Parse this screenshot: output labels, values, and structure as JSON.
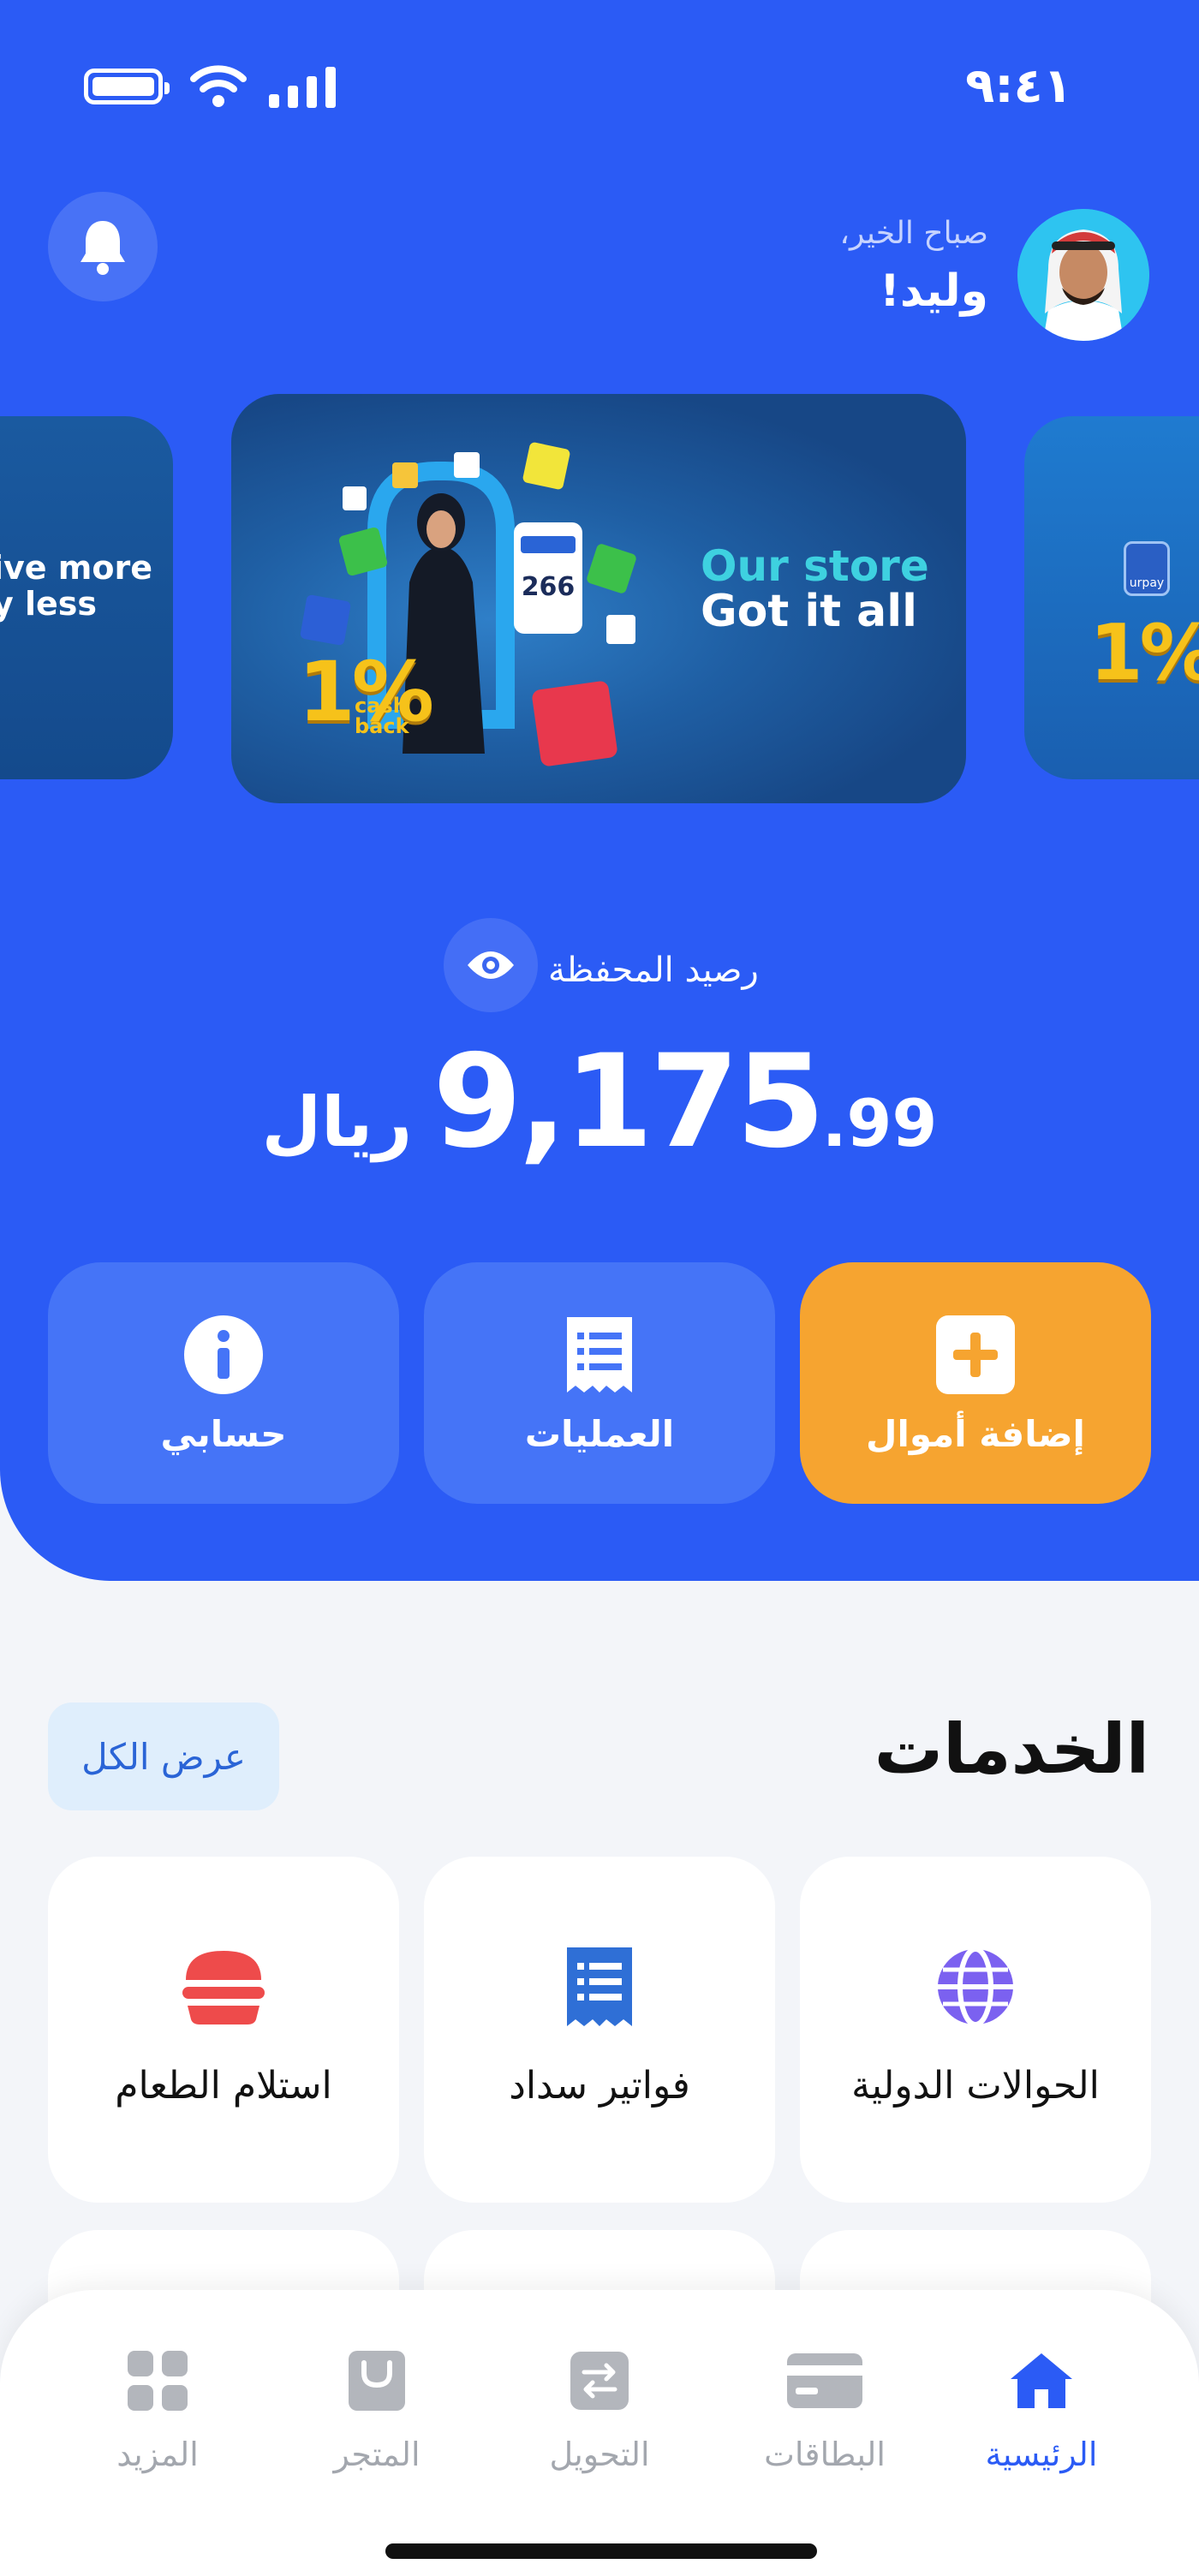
{
  "status_bar": {
    "time": "٩:٤١"
  },
  "header": {
    "greeting": "صباح الخير،",
    "username": "وليد!"
  },
  "banners": [
    {
      "text_lines": [
        "ive more",
        "y less"
      ]
    },
    {
      "line1": "Our store",
      "line2": "Got it all",
      "badge": "1%",
      "badge_sub": "cash back",
      "price_tag": "266"
    },
    {
      "badge": "1%",
      "brand": "urpay"
    }
  ],
  "wallet": {
    "label": "رصيد المحفظة",
    "amount_int": "9,175",
    "amount_dec": ".99",
    "currency": "ريال"
  },
  "actions": [
    {
      "label": "إضافة أموال",
      "icon": "plus-icon"
    },
    {
      "label": "العمليات",
      "icon": "receipt-icon"
    },
    {
      "label": "حسابي",
      "icon": "info-icon"
    }
  ],
  "services": {
    "title": "الخدمات",
    "view_all": "عرض الكل",
    "items": [
      {
        "label": "الحوالات الدولية",
        "icon": "globe-icon"
      },
      {
        "label": "فواتير سداد",
        "icon": "bill-icon"
      },
      {
        "label": "استلام الطعام",
        "icon": "burger-icon"
      }
    ]
  },
  "tabs": [
    {
      "label": "الرئيسية",
      "icon": "home-icon",
      "active": true
    },
    {
      "label": "البطاقات",
      "icon": "card-icon"
    },
    {
      "label": "التحويل",
      "icon": "transfer-icon"
    },
    {
      "label": "المتجر",
      "icon": "bag-icon"
    },
    {
      "label": "المزيد",
      "icon": "grid-icon"
    }
  ],
  "colors": {
    "primary": "#2B5BF5",
    "accent_orange": "#F6A430",
    "action_tile": "#4574F7",
    "globe": "#7B61F0",
    "bill": "#2F6FD6",
    "burger": "#EE4B4B"
  }
}
